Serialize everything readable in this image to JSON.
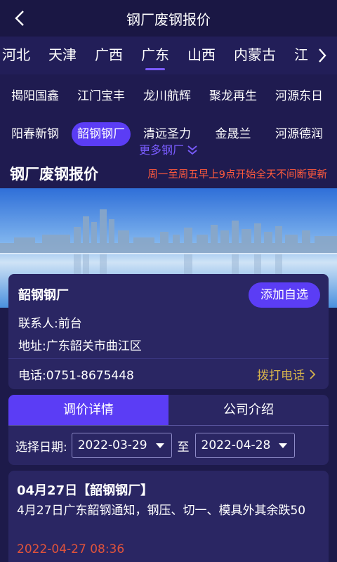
{
  "header": {
    "title": "钢厂废钢报价"
  },
  "provinces": {
    "items": [
      "河北",
      "天津",
      "广西",
      "广东",
      "山西",
      "内蒙古",
      "江西"
    ],
    "active": "广东"
  },
  "mills": {
    "items": [
      "揭阳国鑫",
      "江门宝丰",
      "龙川航辉",
      "聚龙再生",
      "河源东日",
      "阳春新钢",
      "韶钢钢厂",
      "清远圣力",
      "金晟兰",
      "河源德润"
    ],
    "active": "韶钢钢厂",
    "more_label": "更多钢厂"
  },
  "section": {
    "title": "钢厂废钢报价",
    "note": "周一至周五早上9点开始全天不间断更新"
  },
  "company": {
    "name": "韶钢钢厂",
    "add_label": "添加自选",
    "contact": "联系人:前台",
    "address": "地址:广东韶关市曲江区",
    "phone": "电话:0751-8675448",
    "call_label": "拨打电话"
  },
  "tabs": {
    "items": [
      "调价详情",
      "公司介绍"
    ],
    "active": "调价详情"
  },
  "date_filter": {
    "label": "选择日期:",
    "from": "2022-03-29",
    "separator": "至",
    "to": "2022-04-28"
  },
  "news": {
    "title": "04月27日【韶钢钢厂】",
    "body": "4月27日广东韶钢通知，钢压、切一、模具外其余跌50",
    "time": "2022-04-27 08:36"
  },
  "colors": {
    "accent": "#5b3df5",
    "bg": "#1d1a4a",
    "warning": "#ff5a3c",
    "gold": "#d7b44c"
  }
}
